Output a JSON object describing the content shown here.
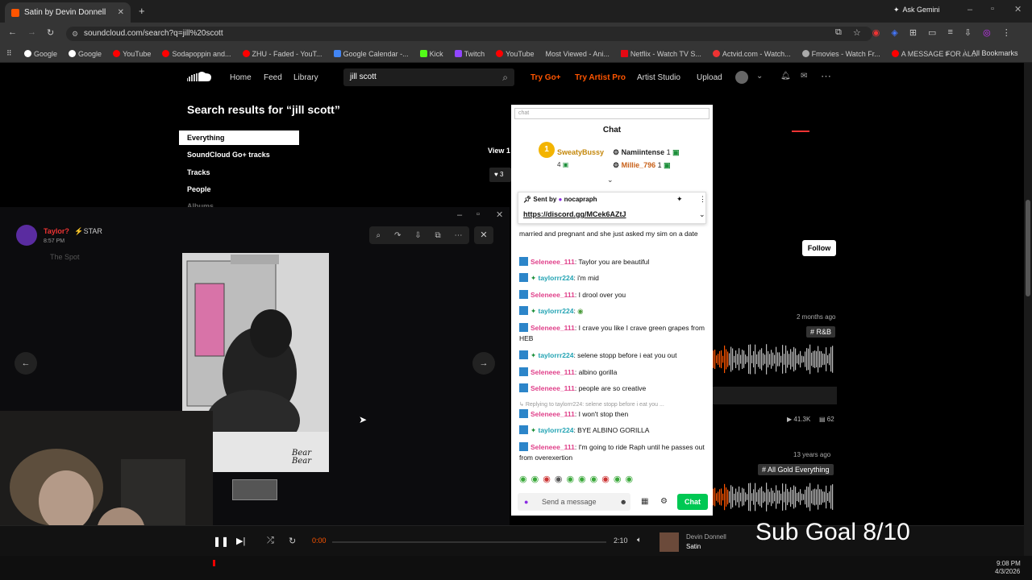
{
  "browser": {
    "tab_title": "Satin by Devin Donnell",
    "url": "soundcloud.com/search?q=jill%20scott",
    "ask_gemini": "Ask Gemini",
    "bookmarks": [
      "Google",
      "Google",
      "YouTube",
      "Sodapoppin and...",
      "ZHU - Faded - YouT...",
      "Google Calendar -...",
      "Kick",
      "Twitch",
      "YouTube",
      "Most Viewed - Ani...",
      "Netflix - Watch TV S...",
      "Actvid.com - Watch...",
      "Fmovies - Watch Fr...",
      "A MESSAGE FOR AL..."
    ],
    "all_bookmarks": "All Bookmarks"
  },
  "soundcloud": {
    "nav": {
      "home": "Home",
      "feed": "Feed",
      "library": "Library",
      "try_go": "Try Go+",
      "try_artist": "Try Artist Pro",
      "artist_studio": "Artist Studio",
      "upload": "Upload"
    },
    "search_value": "jill scott",
    "heading": "Search results for “jill scott”",
    "filters": [
      "Everything",
      "SoundCloud Go+ tracks",
      "Tracks",
      "People",
      "Albums"
    ],
    "view_text": "View 1",
    "like_count": "3",
    "follow": "Follow",
    "track1": {
      "age": "2 months ago",
      "tag": "# R&B",
      "plays": "41.3K",
      "comments": "62"
    },
    "track2": {
      "age": "13 years ago",
      "tag": "# All Gold Everything"
    }
  },
  "viewer": {
    "username": "Taylor?",
    "badge": "STAR",
    "time": "8:57 PM",
    "channel": "The Spot",
    "photo_caption": "Bear\nBear"
  },
  "chat": {
    "search_placeholder": "chat",
    "title": "Chat",
    "leaders": [
      {
        "name": "SweatyBussy",
        "count": "4"
      },
      {
        "name": "Namiintense",
        "count": "1"
      },
      {
        "name": "Millie_796",
        "count": "1"
      }
    ],
    "pinned_label": "Sent by",
    "pinned_user": "nocapraph",
    "pinned_link": "https://discord.gg/MCek6AZtJ",
    "messages": [
      {
        "user": "",
        "text": "married and pregnant and she just asked my sim on a date"
      },
      {
        "user": "Seleneee_111",
        "text": ": Taylor you are beautiful"
      },
      {
        "user": "taylorrr224",
        "text": ": i'm mid"
      },
      {
        "user": "Seleneee_111",
        "text": ": I drool over you"
      },
      {
        "user": "taylorrr224",
        "text": ": "
      },
      {
        "user": "Seleneee_111",
        "text": ": I crave you like I crave green grapes from HEB"
      },
      {
        "user": "taylorrr224",
        "text": ": selene stopp before i eat you out"
      },
      {
        "user": "Seleneee_111",
        "text": ": albino gorilla"
      },
      {
        "user": "Seleneee_111",
        "text": ": people are so creative"
      },
      {
        "user": "Seleneee_111",
        "text": ": I won't stop then"
      },
      {
        "user": "taylorrr224",
        "text": ": BYE ALBINO GORILLA"
      },
      {
        "user": "Seleneee_111",
        "text": ": I'm going to ride Raph until he passes out from overexertion"
      }
    ],
    "reply_text": "Replying to taylorrr224: selene stopp before i eat you ...",
    "input_placeholder": "Send a message",
    "send": "Chat"
  },
  "player": {
    "time_current": "0:00",
    "time_total": "2:10",
    "artist": "Devin Donnell",
    "track": "Satin"
  },
  "overlay": {
    "subgoal": "Sub Goal 8/10"
  },
  "taskbar": {
    "time": "9:08 PM",
    "date": "4/3/2026"
  },
  "colors": {
    "soundcloud_orange": "#ff5500",
    "chat_green": "#00c853",
    "nick_pink": "#e0408a",
    "nick_teal": "#22a3b3"
  }
}
